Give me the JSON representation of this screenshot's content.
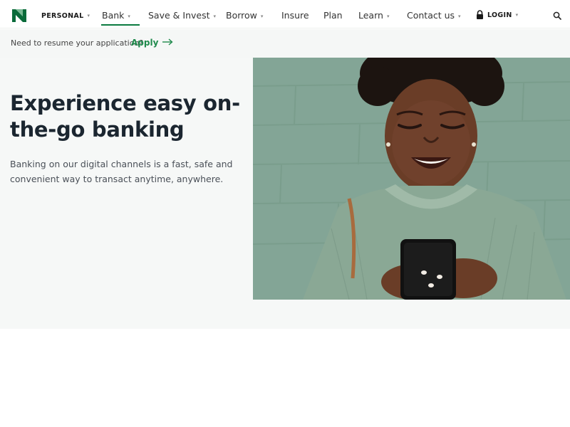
{
  "nav": {
    "segment": "PERSONAL",
    "items": [
      {
        "label": "Bank",
        "caret": true
      },
      {
        "label": "Save & Invest",
        "caret": true
      },
      {
        "label": "Borrow",
        "caret": true
      },
      {
        "label": "Insure",
        "caret": false
      },
      {
        "label": "Plan",
        "caret": false
      },
      {
        "label": "Learn",
        "caret": true
      },
      {
        "label": "Contact us",
        "caret": true
      }
    ],
    "login": "LOGIN",
    "caret_glyph": "▾"
  },
  "resume": {
    "text": "Need to resume your application?",
    "link": "Apply"
  },
  "hero": {
    "title_bold": "Experience easy",
    "title_rest": " on-the-go banking",
    "description": "Banking on our digital channels is a fast, safe and convenient way to transact anytime, anywhere.",
    "image_subject": "woman-smiling-using-phone"
  },
  "colors": {
    "brand_green": "#0a7a3f",
    "link_green": "#1f8a4c",
    "hero_bg": "#f6f8f7",
    "wall_green": "#7e9e90"
  },
  "icons": [
    "nedbank-logo-icon",
    "lock-icon",
    "search-icon",
    "arrow-right-icon",
    "chevron-down-icon"
  ]
}
